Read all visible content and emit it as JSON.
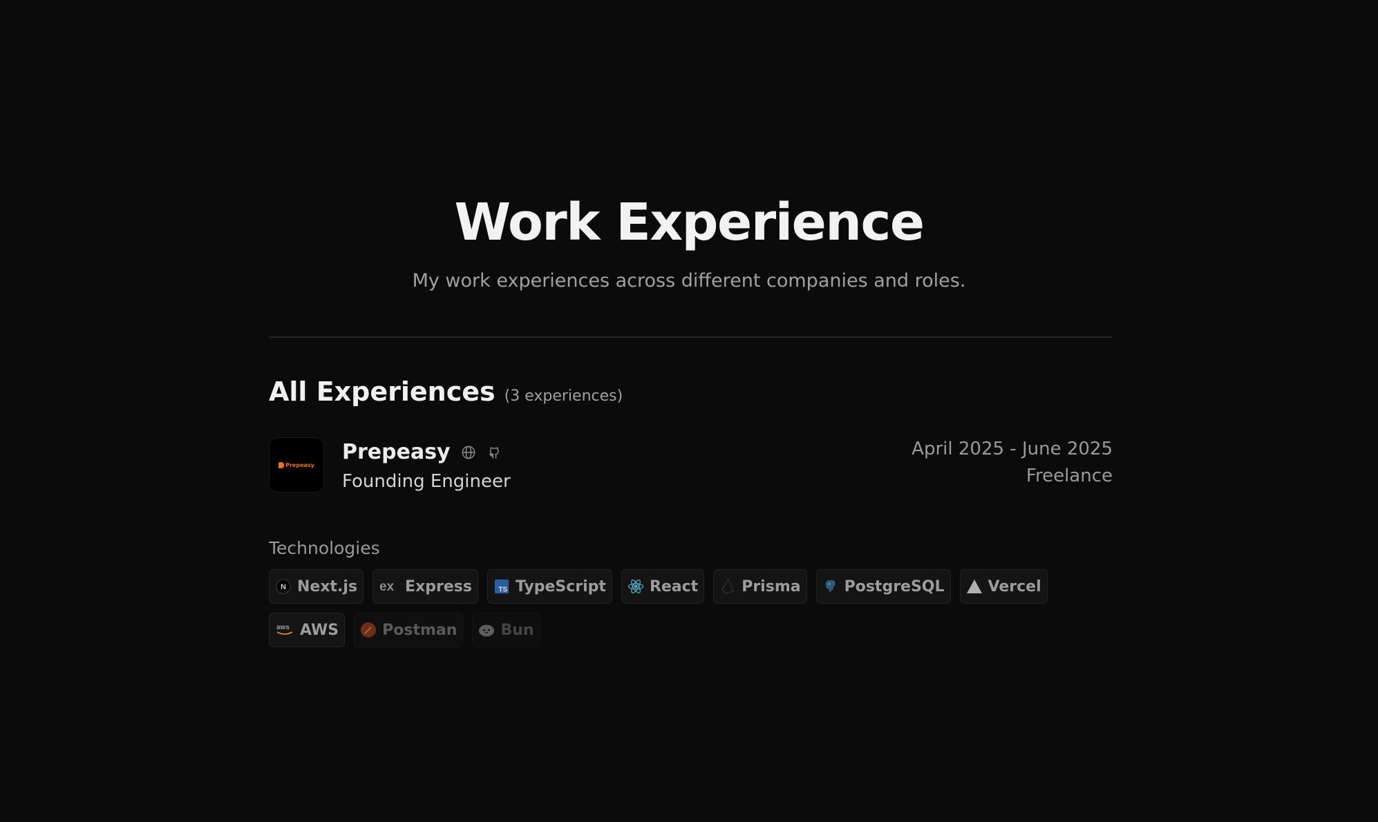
{
  "hero": {
    "title": "Work Experience",
    "subtitle": "My work experiences across different companies and roles."
  },
  "section": {
    "title": "All Experiences",
    "count_label": "(3 experiences)"
  },
  "experience": {
    "company": "Prepeasy",
    "logo_text": "Prepeasy",
    "role": "Founding Engineer",
    "dates": "April 2025 - June 2025",
    "type": "Freelance",
    "links": [
      "globe-icon",
      "github-icon"
    ]
  },
  "technologies": {
    "label": "Technologies",
    "items": [
      {
        "name": "Next.js",
        "icon": "nextjs-icon"
      },
      {
        "name": "Express",
        "icon": "express-icon"
      },
      {
        "name": "TypeScript",
        "icon": "typescript-icon"
      },
      {
        "name": "React",
        "icon": "react-icon"
      },
      {
        "name": "Prisma",
        "icon": "prisma-icon"
      },
      {
        "name": "PostgreSQL",
        "icon": "postgresql-icon"
      },
      {
        "name": "Vercel",
        "icon": "vercel-icon"
      },
      {
        "name": "AWS",
        "icon": "aws-icon"
      },
      {
        "name": "Postman",
        "icon": "postman-icon"
      },
      {
        "name": "Bun",
        "icon": "bun-icon"
      }
    ]
  },
  "colors": {
    "background": "#0b0b0b",
    "brand_orange": "#e8731a",
    "typescript_blue": "#3178c6",
    "react_cyan": "#61dafb"
  }
}
